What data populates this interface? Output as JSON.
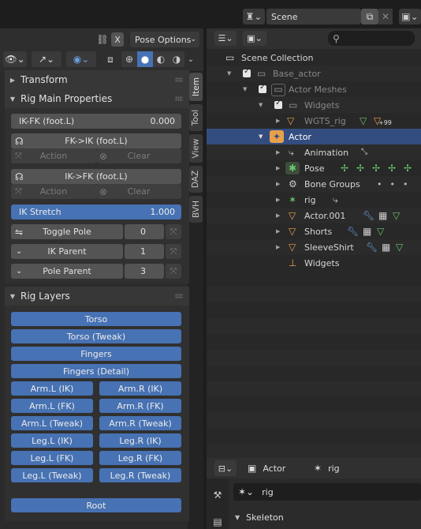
{
  "header": {
    "scene_label": "Scene"
  },
  "left_panel": {
    "toolbar_icons": [
      "pose-icon",
      "snap-icon",
      "overlay-icon",
      "shading-icon"
    ],
    "pose_options_label": "Pose Options",
    "x_label": "X",
    "tabs": [
      "Item",
      "Tool",
      "View",
      "DAZ",
      "BVH"
    ],
    "transform_title": "Transform",
    "rig_main_title": "Rig Main Properties",
    "ikfk": {
      "label": "IK-FK (foot.L)",
      "value": "0.000"
    },
    "fk_to_ik": {
      "label": "FK->IK (foot.L)",
      "action": "Action",
      "clear": "Clear"
    },
    "ik_to_fk": {
      "label": "IK->FK (foot.L)",
      "action": "Action",
      "clear": "Clear"
    },
    "ik_stretch": {
      "label": "IK Stretch",
      "value": "1.000"
    },
    "toggle_pole": {
      "label": "Toggle Pole",
      "value": "0"
    },
    "ik_parent": {
      "label": "IK Parent",
      "value": "1"
    },
    "pole_parent": {
      "label": "Pole Parent",
      "value": "3"
    },
    "rig_layers_title": "Rig Layers",
    "layers_full": [
      "Torso",
      "Torso (Tweak)",
      "Fingers",
      "Fingers (Detail)"
    ],
    "layers_pairs": [
      [
        "Arm.L (IK)",
        "Arm.R (IK)"
      ],
      [
        "Arm.L (FK)",
        "Arm.R (FK)"
      ],
      [
        "Arm.L (Tweak)",
        "Arm.R (Tweak)"
      ],
      [
        "Leg.L (IK)",
        "Leg.R (IK)"
      ],
      [
        "Leg.L (FK)",
        "Leg.R (FK)"
      ],
      [
        "Leg.L (Tweak)",
        "Leg.R (Tweak)"
      ]
    ],
    "root_label": "Root"
  },
  "outliner": {
    "rows": [
      {
        "label": "Scene Collection"
      },
      {
        "label": "Base_actor"
      },
      {
        "label": "Actor Meshes"
      },
      {
        "label": "Widgets"
      },
      {
        "label": "WGTS_rig",
        "badge": "+99"
      },
      {
        "label": "Actor"
      },
      {
        "label": "Animation"
      },
      {
        "label": "Pose"
      },
      {
        "label": "Bone Groups"
      },
      {
        "label": "rig"
      },
      {
        "label": "Actor.001"
      },
      {
        "label": "Shorts"
      },
      {
        "label": "SleeveShirt"
      },
      {
        "label": "Widgets"
      }
    ]
  },
  "properties": {
    "object_label": "Actor",
    "data_label": "rig",
    "field_value": "rig",
    "section_title": "Skeleton"
  },
  "colors": {
    "accent": "#4772b3",
    "selected_row": "#334d80",
    "icon_orange": "#e8a04a",
    "icon_green": "#6cc56c"
  }
}
